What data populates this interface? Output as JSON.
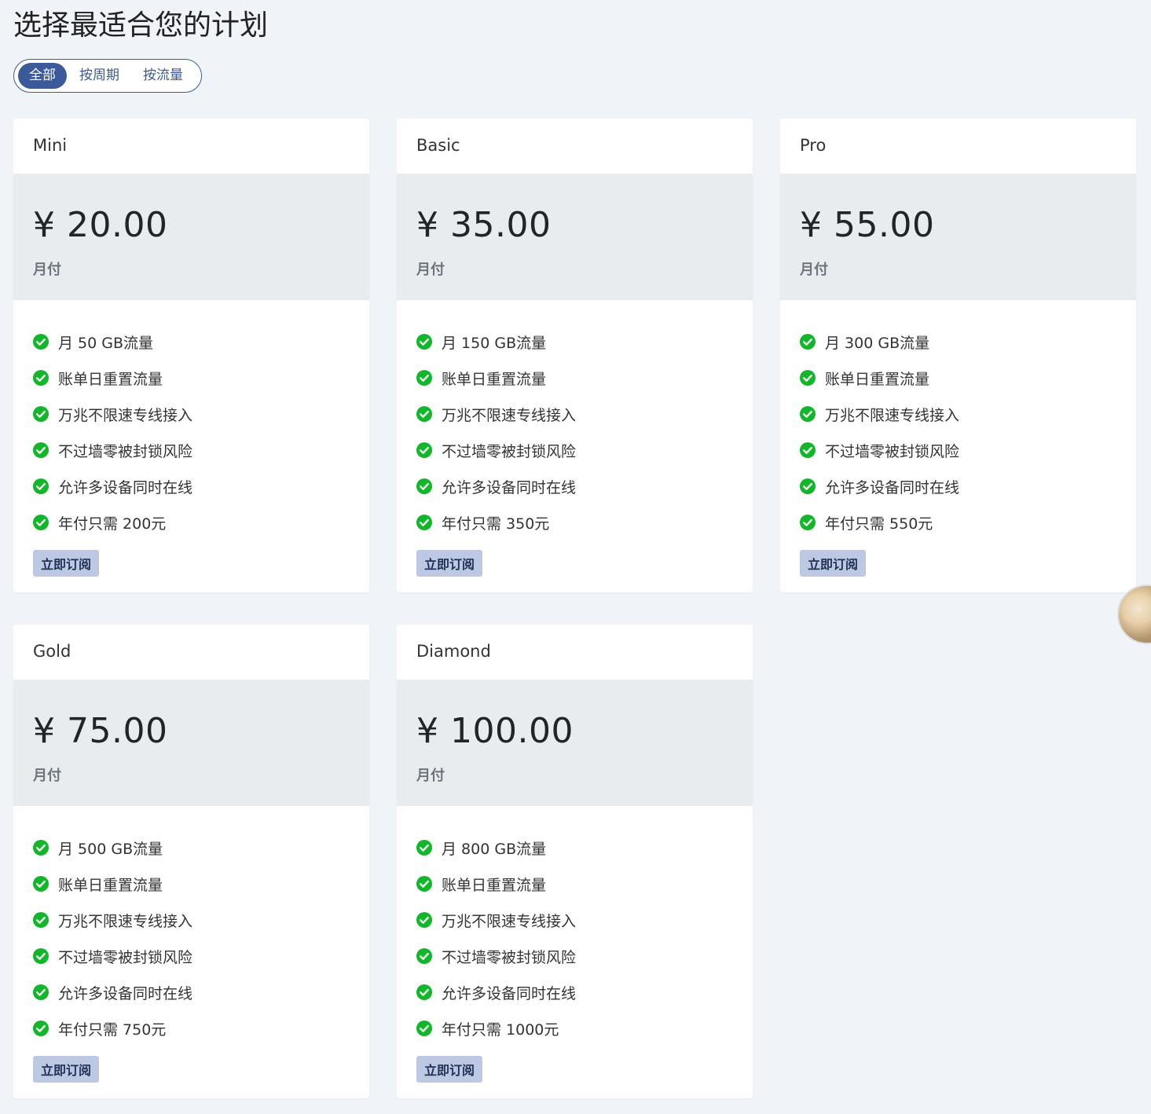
{
  "title": "选择最适合您的计划",
  "filters": [
    {
      "label": "全部",
      "active": true
    },
    {
      "label": "按周期",
      "active": false
    },
    {
      "label": "按流量",
      "active": false
    }
  ],
  "plans": [
    {
      "name": "Mini",
      "price": "¥ 20.00",
      "period": "月付",
      "features": [
        "月 50 GB流量",
        "账单日重置流量",
        "万兆不限速专线接入",
        "不过墙零被封锁风险",
        "允许多设备同时在线",
        "年付只需 200元"
      ],
      "button": "立即订阅"
    },
    {
      "name": "Basic",
      "price": "¥ 35.00",
      "period": "月付",
      "features": [
        "月 150 GB流量",
        "账单日重置流量",
        "万兆不限速专线接入",
        "不过墙零被封锁风险",
        "允许多设备同时在线",
        "年付只需 350元"
      ],
      "button": "立即订阅"
    },
    {
      "name": "Pro",
      "price": "¥ 55.00",
      "period": "月付",
      "features": [
        "月 300 GB流量",
        "账单日重置流量",
        "万兆不限速专线接入",
        "不过墙零被封锁风险",
        "允许多设备同时在线",
        "年付只需 550元"
      ],
      "button": "立即订阅"
    },
    {
      "name": "Gold",
      "price": "¥ 75.00",
      "period": "月付",
      "features": [
        "月 500 GB流量",
        "账单日重置流量",
        "万兆不限速专线接入",
        "不过墙零被封锁风险",
        "允许多设备同时在线",
        "年付只需 750元"
      ],
      "button": "立即订阅"
    },
    {
      "name": "Diamond",
      "price": "¥ 100.00",
      "period": "月付",
      "features": [
        "月 800 GB流量",
        "账单日重置流量",
        "万兆不限速专线接入",
        "不过墙零被封锁风险",
        "允许多设备同时在线",
        "年付只需 1000元"
      ],
      "button": "立即订阅"
    }
  ],
  "colors": {
    "accent": "#3c5a99",
    "check": "#13b52b",
    "button_bg": "#bdc9e3",
    "page_bg": "#f0f3f8"
  },
  "icons": {
    "feature": "check-circle-icon"
  }
}
